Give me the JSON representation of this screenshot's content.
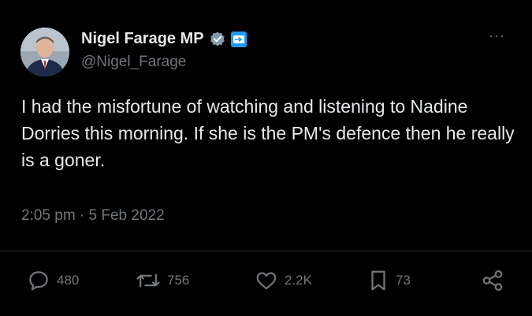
{
  "tweet": {
    "display_name": "Nigel Farage MP",
    "handle": "@Nigel_Farage",
    "text": "I had the misfortune of watching and listening to Nadine Dorries this morning. If she is the PM's defence then he really is a goner.",
    "timestamp": "2:05 pm · 5 Feb 2022",
    "verified_icon": "verified-badge-icon",
    "affiliation_icon": "affiliation-badge-icon",
    "more_label": "···"
  },
  "stats": {
    "replies": "480",
    "retweets": "756",
    "likes": "2.2K",
    "bookmarks": "73"
  },
  "colors": {
    "background": "#000000",
    "text": "#e7e9ea",
    "secondary": "#71767b",
    "accent": "#1d9bf0"
  }
}
